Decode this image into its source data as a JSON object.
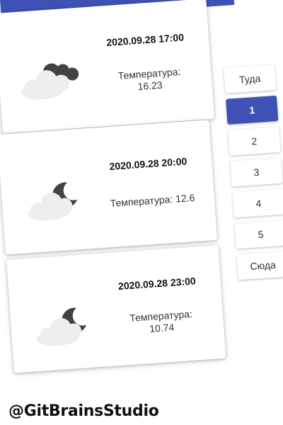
{
  "forecast": [
    {
      "datetime": "2020.09.28 17:00",
      "temperature_label": "Температура:",
      "temperature": "16.23",
      "icon": "cloud-sun-icon"
    },
    {
      "datetime": "2020.09.28 20:00",
      "temperature_label": "Температура:",
      "temperature": "12.6",
      "icon": "cloud-moon-icon"
    },
    {
      "datetime": "2020.09.28 23:00",
      "temperature_label": "Температура:",
      "temperature": "10.74",
      "icon": "cloud-moon-icon"
    }
  ],
  "pagination": {
    "prev_label": "Туда",
    "pages": [
      "1",
      "2",
      "3",
      "4",
      "5"
    ],
    "current_page": "1",
    "next_label": "Сюда"
  },
  "watermark": "@GitBrainsStudio",
  "colors": {
    "accent": "#3f51b5",
    "cloud": "#eeeeee",
    "dark": "#424242"
  }
}
